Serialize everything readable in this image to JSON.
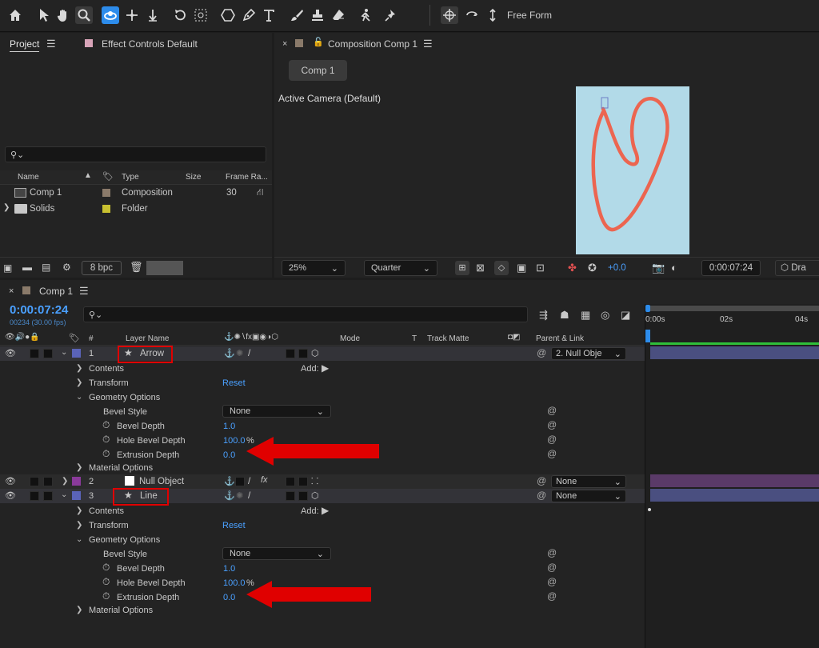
{
  "toolbar": {
    "free_form": "Free Form"
  },
  "project": {
    "tab_project": "Project",
    "tab_effect_controls": "Effect Controls Default",
    "columns": {
      "name": "Name",
      "type": "Type",
      "size": "Size",
      "frame_rate": "Frame Ra..."
    },
    "items": [
      {
        "name": "Comp 1",
        "type": "Composition",
        "frame_rate": "30",
        "swatch": "#8a7a6a"
      },
      {
        "name": "Solids",
        "type": "Folder",
        "frame_rate": "",
        "swatch": "#c8c030"
      }
    ],
    "bpc": "8 bpc"
  },
  "composition": {
    "tab_title": "Composition Comp 1",
    "subtab": "Comp 1",
    "view_label": "Active Camera (Default)",
    "zoom": "25%",
    "resolution": "Quarter",
    "exposure": "+0.0",
    "timecode": "0:00:07:24",
    "draft": "Dra",
    "canvas_bg": "#b2dae8",
    "stroke_color": "#ec6550"
  },
  "timeline": {
    "tab_title": "Comp 1",
    "timecode": "0:00:07:24",
    "frames": "00234 (30.00 fps)",
    "columns": {
      "hash": "#",
      "layer_name": "Layer Name",
      "mode": "Mode",
      "t": "T",
      "track_matte": "Track Matte",
      "parent": "Parent & Link"
    },
    "ruler": [
      "0:00s",
      "02s",
      "04s"
    ],
    "layers": [
      {
        "index": "1",
        "name": "Arrow",
        "parent": "2. Null Obje",
        "color": "#5a63b8"
      },
      {
        "index": "2",
        "name": "Null Object",
        "parent": "None",
        "color": "#8a3a9a"
      },
      {
        "index": "3",
        "name": "Line",
        "parent": "None",
        "color": "#5a63b8"
      }
    ],
    "props": {
      "contents": "Contents",
      "add": "Add:",
      "transform": "Transform",
      "reset": "Reset",
      "geometry": "Geometry Options",
      "bevel_style": "Bevel Style",
      "bevel_style_value": "None",
      "bevel_depth": "Bevel Depth",
      "bevel_depth_value": "1.0",
      "hole_bevel_depth": "Hole Bevel Depth",
      "hole_bevel_value": "100.0",
      "percent": "%",
      "extrusion_depth": "Extrusion Depth",
      "extrusion_value": "0.0",
      "material": "Material Options"
    }
  }
}
